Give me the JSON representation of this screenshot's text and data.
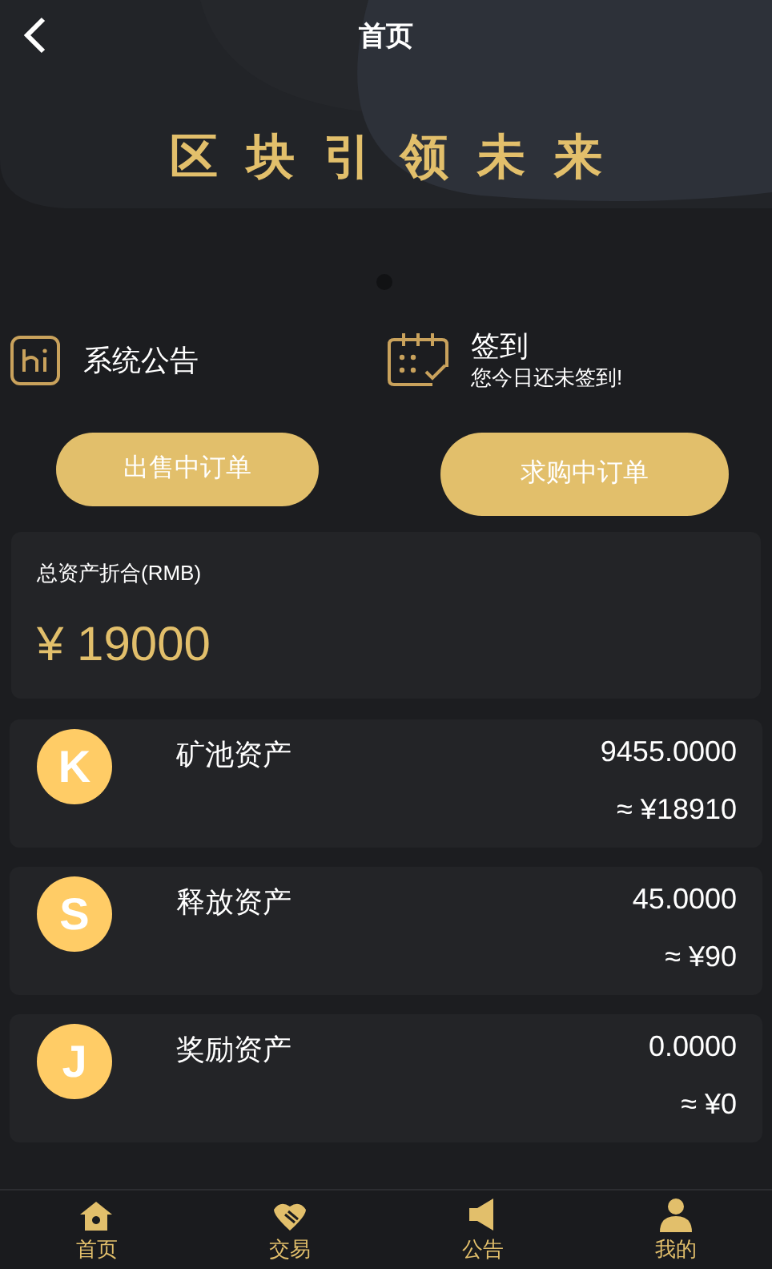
{
  "header": {
    "title": "首页"
  },
  "banner": {
    "title": "区块引领未来"
  },
  "notice": {
    "label": "系统公告"
  },
  "checkin": {
    "title": "签到",
    "subtitle": "您今日还未签到!"
  },
  "buttons": [
    "出售中订单",
    "求购中订单"
  ],
  "total": {
    "label": "总资产折合(RMB)",
    "value": "¥ 19000"
  },
  "assets": [
    {
      "symbol": "K",
      "name": "矿池资产",
      "amount": "9455.0000",
      "approx": "≈ ¥18910"
    },
    {
      "symbol": "S",
      "name": "释放资产",
      "amount": "45.0000",
      "approx": "≈ ¥90"
    },
    {
      "symbol": "J",
      "name": "奖励资产",
      "amount": "0.0000",
      "approx": "≈ ¥0"
    }
  ],
  "tabbar": [
    {
      "kind": "home",
      "label": "首页"
    },
    {
      "kind": "trade",
      "label": "交易"
    },
    {
      "kind": "notice",
      "label": "公告"
    },
    {
      "kind": "user",
      "label": "我的"
    }
  ]
}
